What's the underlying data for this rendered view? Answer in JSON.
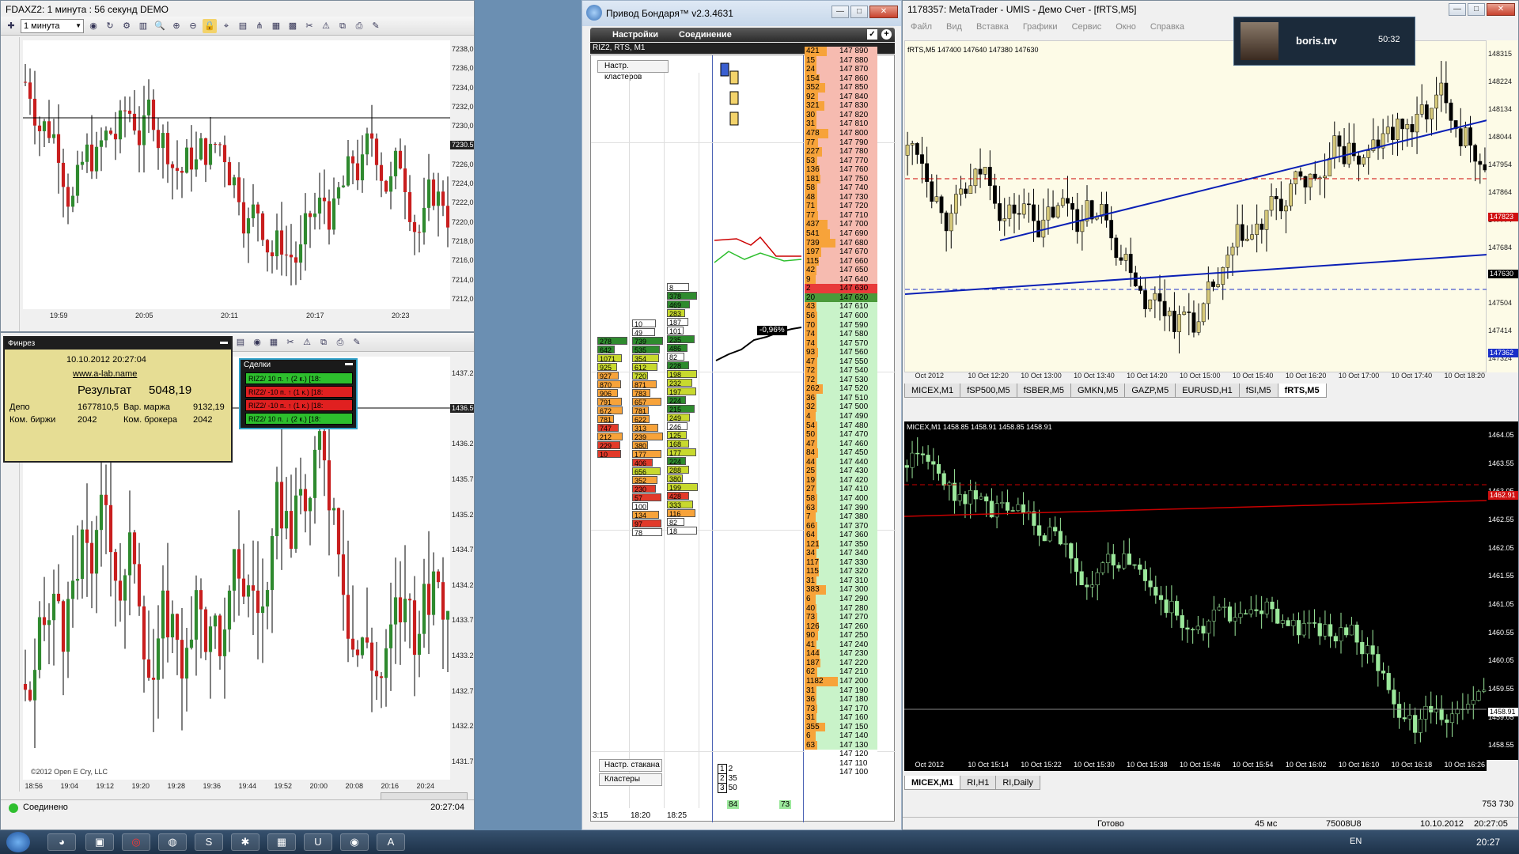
{
  "colors": {
    "up": "#2f8a2f",
    "down": "#c81e1e",
    "bull_mt": "#d6c97a",
    "mt_bg": "#fdfbe7",
    "dark_bg": "#000000",
    "line_blue": "#0a1fb5",
    "line_red": "#c80000",
    "green_light": "#9be89b",
    "orange": "#f7a33a",
    "salmon": "#f6bbb0"
  },
  "win_fdax": {
    "title": "FDAXZ2: 1 минута : 56 секунд DEMO",
    "timeframe": "1 минута",
    "price_label": "7230.5",
    "y_ticks": [
      "7238,0",
      "7236,0",
      "7234,0",
      "7232,0",
      "7230,0",
      "7228,0",
      "7226,0",
      "7224,0",
      "7222,0",
      "7220,0",
      "7218,0",
      "7216,0",
      "7214,0",
      "7212,0"
    ],
    "x_ticks": [
      "19:59",
      "20:05",
      "20:11",
      "20:17",
      "20:23"
    ]
  },
  "win_second": {
    "price_label": "1436.50",
    "y_ticks": [
      "1437.25",
      "1436.75",
      "1436.25",
      "1435.75",
      "1435.25",
      "1434.75",
      "1434.25",
      "1433.75",
      "1433.25",
      "1432.75",
      "1432.25",
      "1431.75"
    ],
    "x_ticks": [
      "18:56",
      "19:04",
      "19:12",
      "19:20",
      "19:28",
      "19:36",
      "19:44",
      "19:52",
      "20:00",
      "20:08",
      "20:16",
      "20:24"
    ],
    "copyright": "©2012 Open E Cry, LLC",
    "status": "Соединено",
    "clock": "20:27:04"
  },
  "finrez": {
    "title": "Финрез",
    "datetime": "10.10.2012 20:27:04",
    "link": "www.a-lab.name",
    "result_label": "Результат",
    "result_value": "5048,19",
    "depo_label": "Депо",
    "depo_value": "1677810,5",
    "margin_label": "Вар. маржа",
    "margin_value": "9132,19",
    "exch_label": "Ком. биржи",
    "exch_value": "2042",
    "broker_label": "Ком. брокера",
    "broker_value": "2042"
  },
  "trades": {
    "title": "Сделки",
    "rows": [
      {
        "text": "RIZ2/ 10 п. ↑ (2 к.) [18:",
        "side": "buy"
      },
      {
        "text": "RIZ2/ -10 п. ↑ (1 к.) [18:",
        "side": "sell"
      },
      {
        "text": "RIZ2/ -10 п. ↑ (1 к.) [18:",
        "side": "sell"
      },
      {
        "text": "RIZ2/ 10 п. ↓ (2 к.) [18:",
        "side": "buy"
      }
    ]
  },
  "bondar": {
    "title": "Привод Бондаря™ v2.3.4631",
    "menu_settings": "Настройки",
    "menu_connection": "Соединение",
    "instrument": "RIZ2, RTS, M1",
    "btn_clusters_settings": "Настр. кластеров",
    "btn_dom_settings": "Настр. стакана",
    "btn_clusters": "Кластеры",
    "time_labels": [
      "3:15",
      "18:20",
      "18:25"
    ],
    "pct_label": "-0,96%",
    "footer_left": "84",
    "footer_right": "73",
    "legend": [
      {
        "k": "1",
        "v": "2"
      },
      {
        "k": "2",
        "v": "35"
      },
      {
        "k": "3",
        "v": "50"
      }
    ],
    "dom": [
      {
        "v": "421",
        "p": "147 890",
        "c": "s"
      },
      {
        "v": "15",
        "p": "147 880",
        "c": "s"
      },
      {
        "v": "24",
        "p": "147 870",
        "c": "s"
      },
      {
        "v": "154",
        "p": "147 860",
        "c": "s"
      },
      {
        "v": "352",
        "p": "147 850",
        "c": "s"
      },
      {
        "v": "92",
        "p": "147 840",
        "c": "s"
      },
      {
        "v": "321",
        "p": "147 830",
        "c": "s"
      },
      {
        "v": "30",
        "p": "147 820",
        "c": "s"
      },
      {
        "v": "31",
        "p": "147 810",
        "c": "s"
      },
      {
        "v": "478",
        "p": "147 800",
        "c": "s"
      },
      {
        "v": "77",
        "p": "147 790",
        "c": "s"
      },
      {
        "v": "227",
        "p": "147 780",
        "c": "s"
      },
      {
        "v": "53",
        "p": "147 770",
        "c": "s"
      },
      {
        "v": "136",
        "p": "147 760",
        "c": "s"
      },
      {
        "v": "181",
        "p": "147 750",
        "c": "s"
      },
      {
        "v": "58",
        "p": "147 740",
        "c": "s"
      },
      {
        "v": "48",
        "p": "147 730",
        "c": "s"
      },
      {
        "v": "71",
        "p": "147 720",
        "c": "s"
      },
      {
        "v": "77",
        "p": "147 710",
        "c": "s"
      },
      {
        "v": "437",
        "p": "147 700",
        "c": "s"
      },
      {
        "v": "541",
        "p": "147 690",
        "c": "s"
      },
      {
        "v": "739",
        "p": "147 680",
        "c": "s"
      },
      {
        "v": "197",
        "p": "147 670",
        "c": "s"
      },
      {
        "v": "115",
        "p": "147 660",
        "c": "s"
      },
      {
        "v": "42",
        "p": "147 650",
        "c": "s"
      },
      {
        "v": "9",
        "p": "147 640",
        "c": "s"
      },
      {
        "v": "2",
        "p": "147 630",
        "c": "r"
      },
      {
        "v": "20",
        "p": "147 620",
        "c": "g"
      },
      {
        "v": "43",
        "p": "147 610",
        "c": "b"
      },
      {
        "v": "56",
        "p": "147 600",
        "c": "b"
      },
      {
        "v": "70",
        "p": "147 590",
        "c": "b"
      },
      {
        "v": "74",
        "p": "147 580",
        "c": "b"
      },
      {
        "v": "74",
        "p": "147 570",
        "c": "b"
      },
      {
        "v": "93",
        "p": "147 560",
        "c": "b"
      },
      {
        "v": "47",
        "p": "147 550",
        "c": "b"
      },
      {
        "v": "72",
        "p": "147 540",
        "c": "b"
      },
      {
        "v": "72",
        "p": "147 530",
        "c": "b"
      },
      {
        "v": "262",
        "p": "147 520",
        "c": "b"
      },
      {
        "v": "36",
        "p": "147 510",
        "c": "b"
      },
      {
        "v": "32",
        "p": "147 500",
        "c": "b"
      },
      {
        "v": "4",
        "p": "147 490",
        "c": "b"
      },
      {
        "v": "54",
        "p": "147 480",
        "c": "b"
      },
      {
        "v": "50",
        "p": "147 470",
        "c": "b"
      },
      {
        "v": "47",
        "p": "147 460",
        "c": "b"
      },
      {
        "v": "84",
        "p": "147 450",
        "c": "b"
      },
      {
        "v": "44",
        "p": "147 440",
        "c": "b"
      },
      {
        "v": "25",
        "p": "147 430",
        "c": "b"
      },
      {
        "v": "19",
        "p": "147 420",
        "c": "b"
      },
      {
        "v": "27",
        "p": "147 410",
        "c": "b"
      },
      {
        "v": "58",
        "p": "147 400",
        "c": "b"
      },
      {
        "v": "63",
        "p": "147 390",
        "c": "b"
      },
      {
        "v": "7",
        "p": "147 380",
        "c": "b"
      },
      {
        "v": "66",
        "p": "147 370",
        "c": "b"
      },
      {
        "v": "64",
        "p": "147 360",
        "c": "b"
      },
      {
        "v": "121",
        "p": "147 350",
        "c": "b"
      },
      {
        "v": "34",
        "p": "147 340",
        "c": "b"
      },
      {
        "v": "117",
        "p": "147 330",
        "c": "b"
      },
      {
        "v": "115",
        "p": "147 320",
        "c": "b"
      },
      {
        "v": "31",
        "p": "147 310",
        "c": "b"
      },
      {
        "v": "383",
        "p": "147 300",
        "c": "b"
      },
      {
        "v": "6",
        "p": "147 290",
        "c": "b"
      },
      {
        "v": "40",
        "p": "147 280",
        "c": "b"
      },
      {
        "v": "73",
        "p": "147 270",
        "c": "b"
      },
      {
        "v": "126",
        "p": "147 260",
        "c": "b"
      },
      {
        "v": "90",
        "p": "147 250",
        "c": "b"
      },
      {
        "v": "41",
        "p": "147 240",
        "c": "b"
      },
      {
        "v": "144",
        "p": "147 230",
        "c": "b"
      },
      {
        "v": "187",
        "p": "147 220",
        "c": "b"
      },
      {
        "v": "62",
        "p": "147 210",
        "c": "b"
      },
      {
        "v": "1182",
        "p": "147 200",
        "c": "b"
      },
      {
        "v": "31",
        "p": "147 190",
        "c": "b"
      },
      {
        "v": "36",
        "p": "147 180",
        "c": "b"
      },
      {
        "v": "73",
        "p": "147 170",
        "c": "b"
      },
      {
        "v": "31",
        "p": "147 160",
        "c": "b"
      },
      {
        "v": "355",
        "p": "147 150",
        "c": "b"
      },
      {
        "v": "6",
        "p": "147 140",
        "c": "b"
      },
      {
        "v": "63",
        "p": "147 130",
        "c": "b"
      },
      {
        "v": "",
        "p": "147 120",
        "c": "n"
      },
      {
        "v": "",
        "p": "147 110",
        "c": "n"
      },
      {
        "v": "",
        "p": "147 100",
        "c": "n"
      }
    ],
    "col1": [
      [
        "278",
        "g"
      ],
      [
        "642",
        "g"
      ],
      [
        "1071",
        "y"
      ],
      [
        "925",
        "y"
      ],
      [
        "927",
        "o"
      ],
      [
        "870",
        "o"
      ],
      [
        "906",
        "o"
      ],
      [
        "791",
        "o"
      ],
      [
        "672",
        "o"
      ],
      [
        "781",
        "o"
      ],
      [
        "747",
        "r"
      ],
      [
        "212",
        "o"
      ],
      [
        "229",
        "r"
      ],
      [
        "10",
        "r"
      ]
    ],
    "col2": [
      [
        "10",
        "w"
      ],
      [
        "49",
        "w"
      ],
      [
        "739",
        "g"
      ],
      [
        "535",
        "g"
      ],
      [
        "354",
        "y"
      ],
      [
        "612",
        "y"
      ],
      [
        "720",
        "y"
      ],
      [
        "871",
        "o"
      ],
      [
        "783",
        "o"
      ],
      [
        "657",
        "o"
      ],
      [
        "781",
        "o"
      ],
      [
        "622",
        "o"
      ],
      [
        "313",
        "o"
      ],
      [
        "239",
        "o"
      ],
      [
        "380",
        "o"
      ],
      [
        "177",
        "o"
      ],
      [
        "406",
        "r"
      ],
      [
        "656",
        "y"
      ],
      [
        "352",
        "o"
      ],
      [
        "230",
        "r"
      ],
      [
        "57",
        "r"
      ],
      [
        "100",
        "w"
      ],
      [
        "134",
        "o"
      ],
      [
        "97",
        "r"
      ],
      [
        "78",
        "w"
      ]
    ],
    "col3": [
      [
        "8",
        "w"
      ],
      [
        "378",
        "g"
      ],
      [
        "469",
        "g"
      ],
      [
        "283",
        "y"
      ],
      [
        "187",
        "w"
      ],
      [
        "101",
        "w"
      ],
      [
        "235",
        "g"
      ],
      [
        "486",
        "g"
      ],
      [
        "82",
        "w"
      ],
      [
        "228",
        "g"
      ],
      [
        "198",
        "y"
      ],
      [
        "232",
        "y"
      ],
      [
        "197",
        "y"
      ],
      [
        "224",
        "g"
      ],
      [
        "215",
        "g"
      ],
      [
        "249",
        "y"
      ],
      [
        "246",
        "w"
      ],
      [
        "125",
        "y"
      ],
      [
        "168",
        "y"
      ],
      [
        "177",
        "y"
      ],
      [
        "224",
        "g"
      ],
      [
        "288",
        "y"
      ],
      [
        "380",
        "y"
      ],
      [
        "199",
        "y"
      ],
      [
        "428",
        "r"
      ],
      [
        "333",
        "y"
      ],
      [
        "116",
        "o"
      ],
      [
        "82",
        "w"
      ],
      [
        "18",
        "w"
      ]
    ]
  },
  "mt_top": {
    "title": "1178357: MetaTrader - UMIS - Демо Счет - [fRTS,M5]",
    "menu": [
      "Файл",
      "Вид",
      "Вставка",
      "Графики",
      "Сервис",
      "Окно",
      "Справка"
    ],
    "info": "fRTS,M5  147400 147640 147380 147630",
    "y_ticks": [
      "148315",
      "148224",
      "148134",
      "148044",
      "147954",
      "147864",
      "147774",
      "147684",
      "147594",
      "147504",
      "147414",
      "147324"
    ],
    "level_label": "147823",
    "price_label": "147630",
    "low_label": "147362",
    "x_ticks": [
      "Oct 2012",
      "10 Oct 12:20",
      "10 Oct 13:00",
      "10 Oct 13:40",
      "10 Oct 14:20",
      "10 Oct 15:00",
      "10 Oct 15:40",
      "10 Oct 16:20",
      "10 Oct 17:00",
      "10 Oct 17:40",
      "10 Oct 18:20"
    ],
    "tabs": [
      "MICEX,M1",
      "fSP500,M5",
      "fSBER,M5",
      "GMKN,M5",
      "GAZP,M5",
      "EURUSD,H1",
      "fSI,M5",
      "fRTS,M5"
    ],
    "active_tab": "fRTS,M5"
  },
  "mt_bottom": {
    "info": "MICEX,M1  1458.85 1458.91 1458.85 1458.91",
    "y_ticks": [
      "1464.05",
      "1463.55",
      "1463.05",
      "1462.55",
      "1462.05",
      "1461.55",
      "1461.05",
      "1460.55",
      "1460.05",
      "1459.55",
      "1459.05",
      "1458.55"
    ],
    "price_label": "1458.91",
    "red_label": "1462.91",
    "x_ticks": [
      "Oct 2012",
      "10 Oct 15:14",
      "10 Oct 15:22",
      "10 Oct 15:30",
      "10 Oct 15:38",
      "10 Oct 15:46",
      "10 Oct 15:54",
      "10 Oct 16:02",
      "10 Oct 16:10",
      "10 Oct 16:18",
      "10 Oct 16:26"
    ],
    "tabs": [
      "MICEX,M1",
      "RI,H1",
      "RI,Daily"
    ],
    "active_tab": "MICEX,M1",
    "status_ready": "Готово",
    "status_ping": "45 мс",
    "status_traffic": "75008U8",
    "status_size": "753 730"
  },
  "skype": {
    "name": "boris.trv",
    "time": "50:32"
  },
  "tray": {
    "lang": "EN",
    "time": "20:27",
    "date": "10.10.2012",
    "clock2": "20:27:05"
  }
}
